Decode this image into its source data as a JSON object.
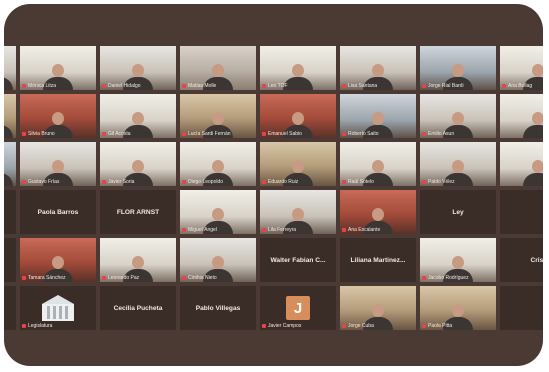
{
  "tiles": [
    {
      "kind": "video",
      "style": "v2",
      "label": "",
      "name": ""
    },
    {
      "kind": "video",
      "style": "v6",
      "label": "Mónica Litza",
      "name": ""
    },
    {
      "kind": "video",
      "style": "v2",
      "label": "Daniel Hidalgo",
      "name": ""
    },
    {
      "kind": "video",
      "style": "v1",
      "label": "Matías Molle",
      "name": ""
    },
    {
      "kind": "video",
      "style": "v6",
      "label": "Leo TOF",
      "name": ""
    },
    {
      "kind": "video",
      "style": "v2",
      "label": "Lisa Santana",
      "name": ""
    },
    {
      "kind": "video",
      "style": "v3",
      "label": "Jorge Rial Bardi",
      "name": ""
    },
    {
      "kind": "video",
      "style": "v6",
      "label": "Ana Bollag",
      "name": ""
    },
    {
      "kind": "video",
      "style": "v2",
      "label": "",
      "name": ""
    },
    {
      "kind": "video",
      "style": "v4",
      "label": "",
      "name": ""
    },
    {
      "kind": "video",
      "style": "v5",
      "label": "Silvia Bruno",
      "name": ""
    },
    {
      "kind": "video",
      "style": "v6",
      "label": "Gil Acosta",
      "name": ""
    },
    {
      "kind": "video",
      "style": "v4",
      "label": "Lucía Sardi Fernán",
      "name": ""
    },
    {
      "kind": "video",
      "style": "v5",
      "label": "Emanuel Sabio",
      "name": ""
    },
    {
      "kind": "video",
      "style": "v3",
      "label": "Roberto Saito",
      "name": ""
    },
    {
      "kind": "video",
      "style": "v2",
      "label": "Emilio Asun",
      "name": ""
    },
    {
      "kind": "video",
      "style": "v6",
      "label": "",
      "name": ""
    },
    {
      "kind": "video",
      "style": "v6",
      "label": "",
      "name": ""
    },
    {
      "kind": "video",
      "style": "v3",
      "label": "",
      "name": ""
    },
    {
      "kind": "video",
      "style": "v2",
      "label": "Gustavo Frías",
      "name": ""
    },
    {
      "kind": "video",
      "style": "v6",
      "label": "Javier Soria",
      "name": ""
    },
    {
      "kind": "video",
      "style": "v6",
      "label": "Diego Leopoldo",
      "name": ""
    },
    {
      "kind": "video",
      "style": "v4",
      "label": "Eduardo Ruiz",
      "name": ""
    },
    {
      "kind": "video",
      "style": "v6",
      "label": "Raúl Sotelo",
      "name": ""
    },
    {
      "kind": "video",
      "style": "v2",
      "label": "Pablo Vélez",
      "name": ""
    },
    {
      "kind": "video",
      "style": "v6",
      "label": "",
      "name": ""
    },
    {
      "kind": "video",
      "style": "v6",
      "label": "",
      "name": ""
    },
    {
      "kind": "name",
      "style": "",
      "label": "",
      "name": "bel"
    },
    {
      "kind": "name",
      "style": "",
      "label": "",
      "name": "Paola Barros"
    },
    {
      "kind": "name",
      "style": "",
      "label": "",
      "name": "FLOR ARNST"
    },
    {
      "kind": "video",
      "style": "v6",
      "label": "Miguel Ángel",
      "name": ""
    },
    {
      "kind": "video",
      "style": "v2",
      "label": "Lila Ferreyra",
      "name": ""
    },
    {
      "kind": "video",
      "style": "v5",
      "label": "Ana Escalante",
      "name": ""
    },
    {
      "kind": "name",
      "style": "",
      "label": "",
      "name": "Ley"
    },
    {
      "kind": "name",
      "style": "",
      "label": "",
      "name": ""
    },
    {
      "kind": "name",
      "style": "",
      "label": "",
      "name": ""
    },
    {
      "kind": "name",
      "style": "",
      "label": "",
      "name": "nsa"
    },
    {
      "kind": "video",
      "style": "v5",
      "label": "Tamara Sánchez",
      "name": ""
    },
    {
      "kind": "video",
      "style": "v6",
      "label": "Leonardo Paz",
      "name": ""
    },
    {
      "kind": "video",
      "style": "v2",
      "label": "Cinthia Nieto",
      "name": ""
    },
    {
      "kind": "name",
      "style": "",
      "label": "",
      "name": "Walter Fabian C..."
    },
    {
      "kind": "name",
      "style": "",
      "label": "",
      "name": "Liliana Martinez..."
    },
    {
      "kind": "video",
      "style": "v6",
      "label": "Jacobo Rodríguez",
      "name": ""
    },
    {
      "kind": "name",
      "style": "",
      "label": "",
      "name": "Crist"
    },
    {
      "kind": "name",
      "style": "",
      "label": "",
      "name": ""
    },
    {
      "kind": "name",
      "style": "",
      "label": "",
      "name": ""
    },
    {
      "kind": "building",
      "style": "",
      "label": "Legislatura",
      "name": ""
    },
    {
      "kind": "name",
      "style": "",
      "label": "",
      "name": "Cecilia Pucheta"
    },
    {
      "kind": "name",
      "style": "",
      "label": "",
      "name": "Pablo Villegas"
    },
    {
      "kind": "avatar",
      "style": "",
      "label": "Javier Campos",
      "name": "J"
    },
    {
      "kind": "video",
      "style": "v4",
      "label": "Jorge Cuba",
      "name": ""
    },
    {
      "kind": "video",
      "style": "v4",
      "label": "Paola Pitta",
      "name": ""
    },
    {
      "kind": "name",
      "style": "",
      "label": "",
      "name": ""
    },
    {
      "kind": "name",
      "style": "",
      "label": "",
      "name": ""
    }
  ]
}
